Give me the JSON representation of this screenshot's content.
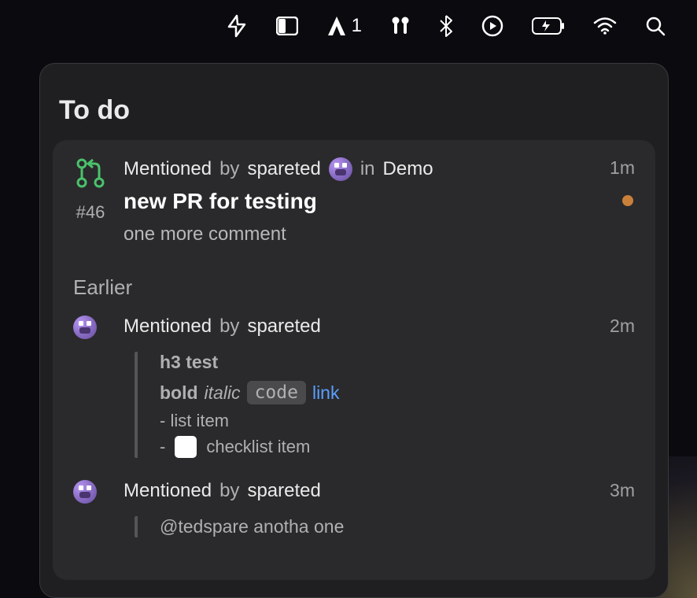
{
  "menubar": {
    "app_badge": "1"
  },
  "panel": {
    "title": "To do"
  },
  "notification": {
    "label": "Mentioned",
    "by_text": "by",
    "author": "spareted",
    "in_text": "in",
    "repo": "Demo",
    "number": "#46",
    "title": "new PR for testing",
    "description": "one more comment",
    "timestamp": "1m"
  },
  "earlier": {
    "section_title": "Earlier",
    "items": [
      {
        "label": "Mentioned",
        "by_text": "by",
        "author": "spareted",
        "timestamp": "2m",
        "content": {
          "h3": "h3 test",
          "bold": "bold",
          "italic": "italic",
          "code": "code",
          "link": "link",
          "list_item": "- list item",
          "dash": "-",
          "checklist_item": "checklist item"
        }
      },
      {
        "label": "Mentioned",
        "by_text": "by",
        "author": "spareted",
        "timestamp": "3m",
        "mention_text": "@tedspare anotha one"
      }
    ]
  }
}
